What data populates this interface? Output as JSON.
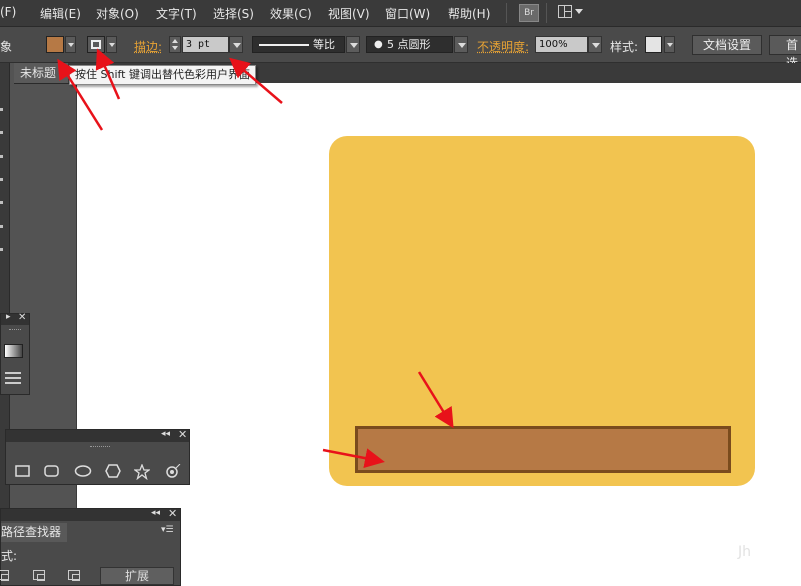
{
  "menubar": {
    "items": [
      "(F)",
      "编辑(E)",
      "对象(O)",
      "文字(T)",
      "选择(S)",
      "效果(C)",
      "视图(V)",
      "窗口(W)",
      "帮助(H)"
    ],
    "bridge_label": "Br",
    "workspace_icon": "workspace-layout-icon"
  },
  "control_bar": {
    "mode_label": "象",
    "fill_color": "#b67945",
    "stroke_link": "描边:",
    "stroke_weight": "3 pt",
    "profile_label": "等比",
    "brush_label": "5 点圆形",
    "opacity_link": "不透明度:",
    "opacity_value": "100%",
    "style_label": "样式:",
    "doc_setup_button": "文档设置",
    "prefs_button": "首选"
  },
  "tooltip": {
    "text": "按住 Shift 键调出替代色彩用户界面"
  },
  "document": {
    "tab_title": "未标题"
  },
  "canvas": {
    "background_color": "#f2c450",
    "bar_fill": "#b67945",
    "bar_stroke": "#7a4b1d",
    "watermark": "Jh"
  },
  "shapes_panel": {
    "icons": [
      "rectangle-icon",
      "rounded-rectangle-icon",
      "ellipse-icon",
      "polygon-icon",
      "star-icon",
      "flare-icon"
    ]
  },
  "pathfinder_panel": {
    "title": "路径查找器",
    "shape_modes_label": "式:",
    "expand_button": "扩展"
  },
  "annotations": {
    "arrow_color": "#e8121a"
  }
}
